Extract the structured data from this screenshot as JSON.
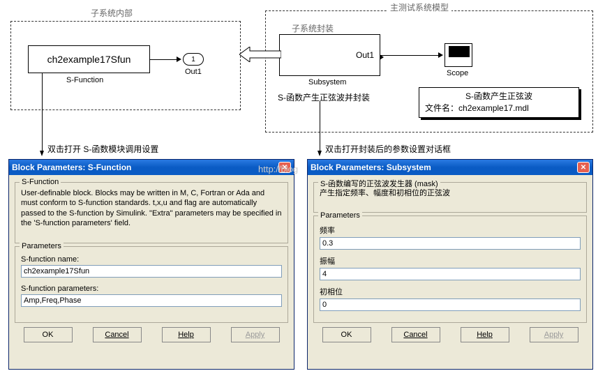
{
  "top": {
    "left_label": "子系统内部",
    "right_label": "主测试系统模型",
    "mid_label": "子系统封装",
    "sfun_block": "ch2example17Sfun",
    "sfun_caption": "S-Function",
    "out_port": "1",
    "out_port_caption": "Out1",
    "subsystem_out": "Out1",
    "subsystem_caption": "Subsystem",
    "subsystem_note": "S-函数产生正弦波并封装",
    "scope_caption": "Scope",
    "info_line1": "S-函数产生正弦波",
    "info_line2_prefix": "文件名：",
    "info_line2_file": "ch2example17.mdl"
  },
  "callouts": {
    "left": "双击打开 S-函数模块调用设置",
    "right": "双击打开封装后的参数设置对话框"
  },
  "watermark": "http://blog",
  "dialog_left": {
    "title": "Block Parameters: S-Function",
    "group1_title": "S-Function",
    "desc": "User-definable block.  Blocks may be written in M, C, Fortran or Ada and must  conform to S-function standards. t,x,u and flag are automatically passed to the S-function by Simulink.  \"Extra\" parameters may be specified in the 'S-function parameters' field.",
    "group2_title": "Parameters",
    "label_name": "S-function name:",
    "val_name": "ch2example17Sfun",
    "label_params": "S-function parameters:",
    "val_params": "Amp,Freq,Phase",
    "btn_ok": "OK",
    "btn_cancel": "Cancel",
    "btn_help": "Help",
    "btn_apply": "Apply"
  },
  "dialog_right": {
    "title": "Block Parameters: Subsystem",
    "group1_title": "S-函数编写的正弦波发生器 (mask)",
    "desc": "产生指定频率、幅度和初相位的正弦波",
    "group2_title": "Parameters",
    "label_freq": "频率",
    "val_freq": "0.3",
    "label_amp": "振幅",
    "val_amp": "4",
    "label_phase": "初相位",
    "val_phase": "0",
    "btn_ok": "OK",
    "btn_cancel": "Cancel",
    "btn_help": "Help",
    "btn_apply": "Apply"
  }
}
